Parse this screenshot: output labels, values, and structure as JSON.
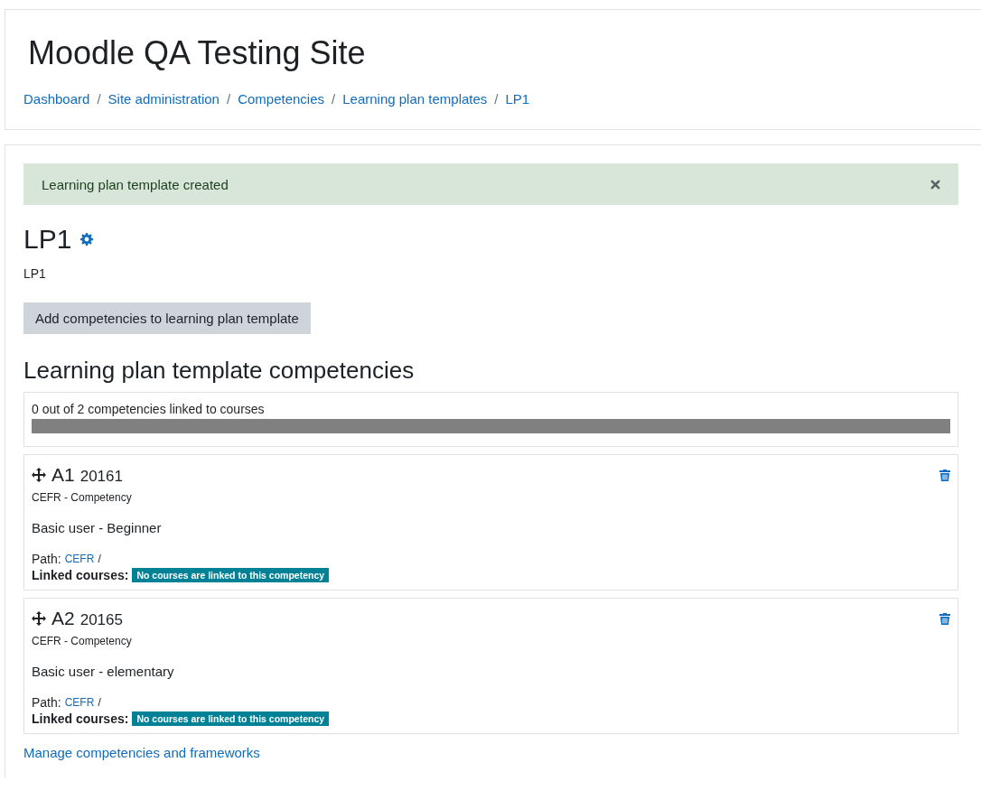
{
  "header": {
    "site_title": "Moodle QA Testing Site",
    "breadcrumbs": [
      "Dashboard",
      "Site administration",
      "Competencies",
      "Learning plan templates",
      "LP1"
    ],
    "separator": "/"
  },
  "alert": {
    "message": "Learning plan template created"
  },
  "template": {
    "title": "LP1",
    "description": "LP1"
  },
  "add_button": "Add competencies to learning plan template",
  "section_title": "Learning plan template competencies",
  "progress": {
    "label": "0 out of 2 competencies linked to courses",
    "level": 0
  },
  "competencies": [
    {
      "shortname": "A1",
      "idnumber": "20161",
      "framework": "CEFR - Competency",
      "description": "Basic user - Beginner",
      "path_label": "Path:",
      "path_link": "CEFR",
      "path_sep": "/",
      "linked_label": "Linked courses:",
      "linked_badge": "No courses are linked to this competency"
    },
    {
      "shortname": "A2",
      "idnumber": "20165",
      "framework": "CEFR - Competency",
      "description": "Basic user - elementary",
      "path_label": "Path:",
      "path_link": "CEFR",
      "path_sep": "/",
      "linked_label": "Linked courses:",
      "linked_badge": "No courses are linked to this competency"
    }
  ],
  "footer_link": "Manage competencies and frameworks"
}
